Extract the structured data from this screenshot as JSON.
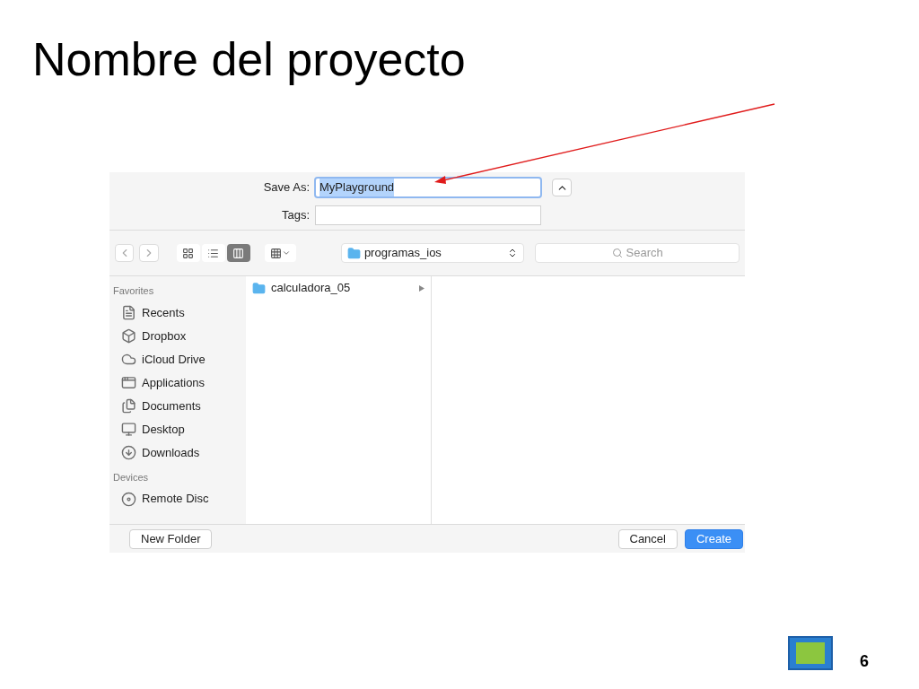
{
  "slide": {
    "title": "Nombre del proyecto",
    "page_number": "6"
  },
  "dialog": {
    "save_as": {
      "label": "Save As:",
      "value": "MyPlayground",
      "value_selected": true
    },
    "tags": {
      "label": "Tags:"
    },
    "view_modes": [
      {
        "kind": "icons",
        "selected": false
      },
      {
        "kind": "list",
        "selected": false
      },
      {
        "kind": "columns",
        "selected": true
      }
    ],
    "location": "programas_ios",
    "search": {
      "placeholder": "Search"
    },
    "sidebar": [
      {
        "heading": "Favorites",
        "items": [
          {
            "label": "Recents",
            "kind": "recents"
          },
          {
            "label": "Dropbox",
            "kind": "dropbox"
          },
          {
            "label": "iCloud Drive",
            "kind": "cloud"
          },
          {
            "label": "Applications",
            "kind": "apps"
          },
          {
            "label": "Documents",
            "kind": "documents"
          },
          {
            "label": "Desktop",
            "kind": "desktop"
          },
          {
            "label": "Downloads",
            "kind": "downloads"
          }
        ]
      },
      {
        "heading": "Devices",
        "items": [
          {
            "label": "Remote Disc",
            "kind": "disc"
          }
        ]
      }
    ],
    "column_items": [
      {
        "label": "calculadora_05",
        "selected": false
      }
    ],
    "buttons": [
      {
        "label": "New Folder",
        "kind": "secondary"
      },
      {
        "label": "Cancel",
        "kind": "secondary"
      },
      {
        "label": "Create",
        "kind": "primary"
      }
    ]
  }
}
